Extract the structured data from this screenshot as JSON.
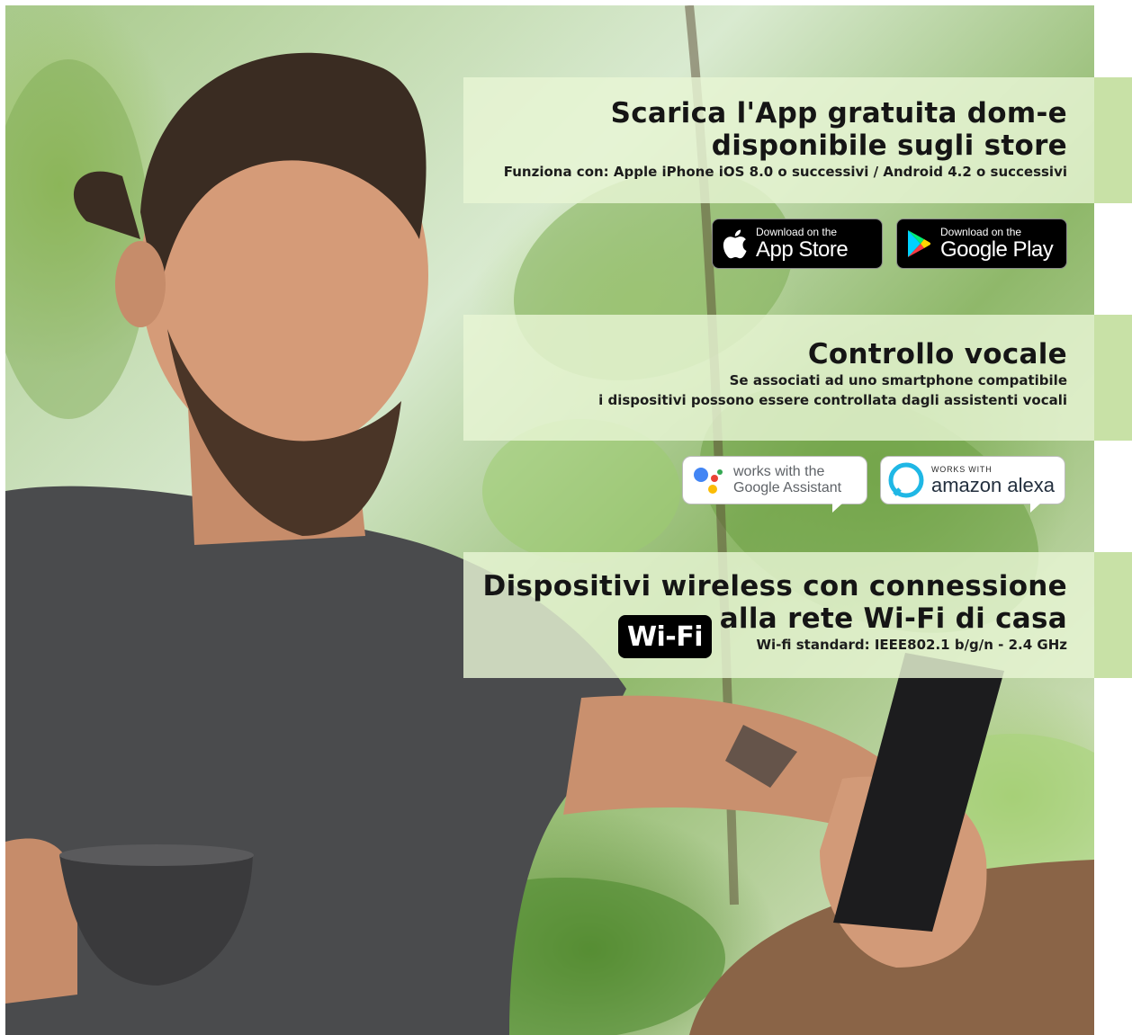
{
  "app_section": {
    "title_line1": "Scarica l'App gratuita dom-e",
    "title_line2": "disponibile sugli store",
    "compat": "Funziona con: Apple iPhone iOS 8.0 o successivi / Android 4.2 o successivi"
  },
  "store_badges": {
    "apple": {
      "line1": "Download on the",
      "line2": "App Store",
      "icon": "apple-icon"
    },
    "google": {
      "line1": "Download on the",
      "line2": "Google Play",
      "icon": "google-play-icon"
    }
  },
  "voice_section": {
    "title": "Controllo vocale",
    "line1": "Se associati ad uno smartphone compatibile",
    "line2": "i dispositivi possono essere controllata dagli assistenti vocali"
  },
  "assistant_badges": {
    "google": {
      "line1": "works with the",
      "line2": "Google Assistant",
      "icon": "google-assistant-icon"
    },
    "alexa": {
      "line1": "WORKS WITH",
      "line2": "amazon alexa",
      "icon": "alexa-icon"
    }
  },
  "wifi_section": {
    "title_line1": "Dispositivi wireless con connessione",
    "title_line2": "alla rete Wi-Fi di casa",
    "standard": "Wi-fi standard: IEEE802.1 b/g/n - 2.4 GHz",
    "logo_text": "Wi-Fi"
  },
  "colors": {
    "panel_bg": "#e8f5d4",
    "strip": "#bedc96",
    "text": "#151515",
    "badge_bg": "#000000"
  }
}
